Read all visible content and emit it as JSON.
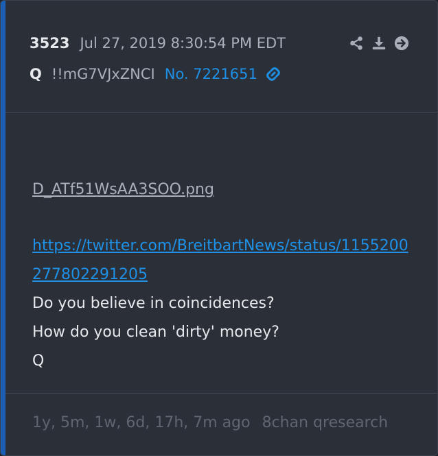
{
  "post": {
    "number": "3523",
    "timestamp": "Jul 27, 2019 8:30:54 PM EDT",
    "author": "Q",
    "tripcode": "!!mG7VJxZNCI",
    "post_link": "No. 7221651"
  },
  "actions": [
    "share-icon",
    "download-icon",
    "arrow-right-circle-icon"
  ],
  "body": {
    "image_filename": "D_ATf51WsAA3SOO.png",
    "url": "https://twitter.com/BreitbartNews/status/1155200277802291205",
    "lines": [
      "Do you believe in coincidences?",
      "How do you clean 'dirty' money?",
      "Q"
    ]
  },
  "footer": {
    "age": "1y, 5m, 1w, 6d, 17h, 7m ago",
    "source": "8chan qresearch"
  },
  "colors": {
    "accent": "#1a5fb4",
    "link": "#1e90e6",
    "background": "#2b3038"
  }
}
